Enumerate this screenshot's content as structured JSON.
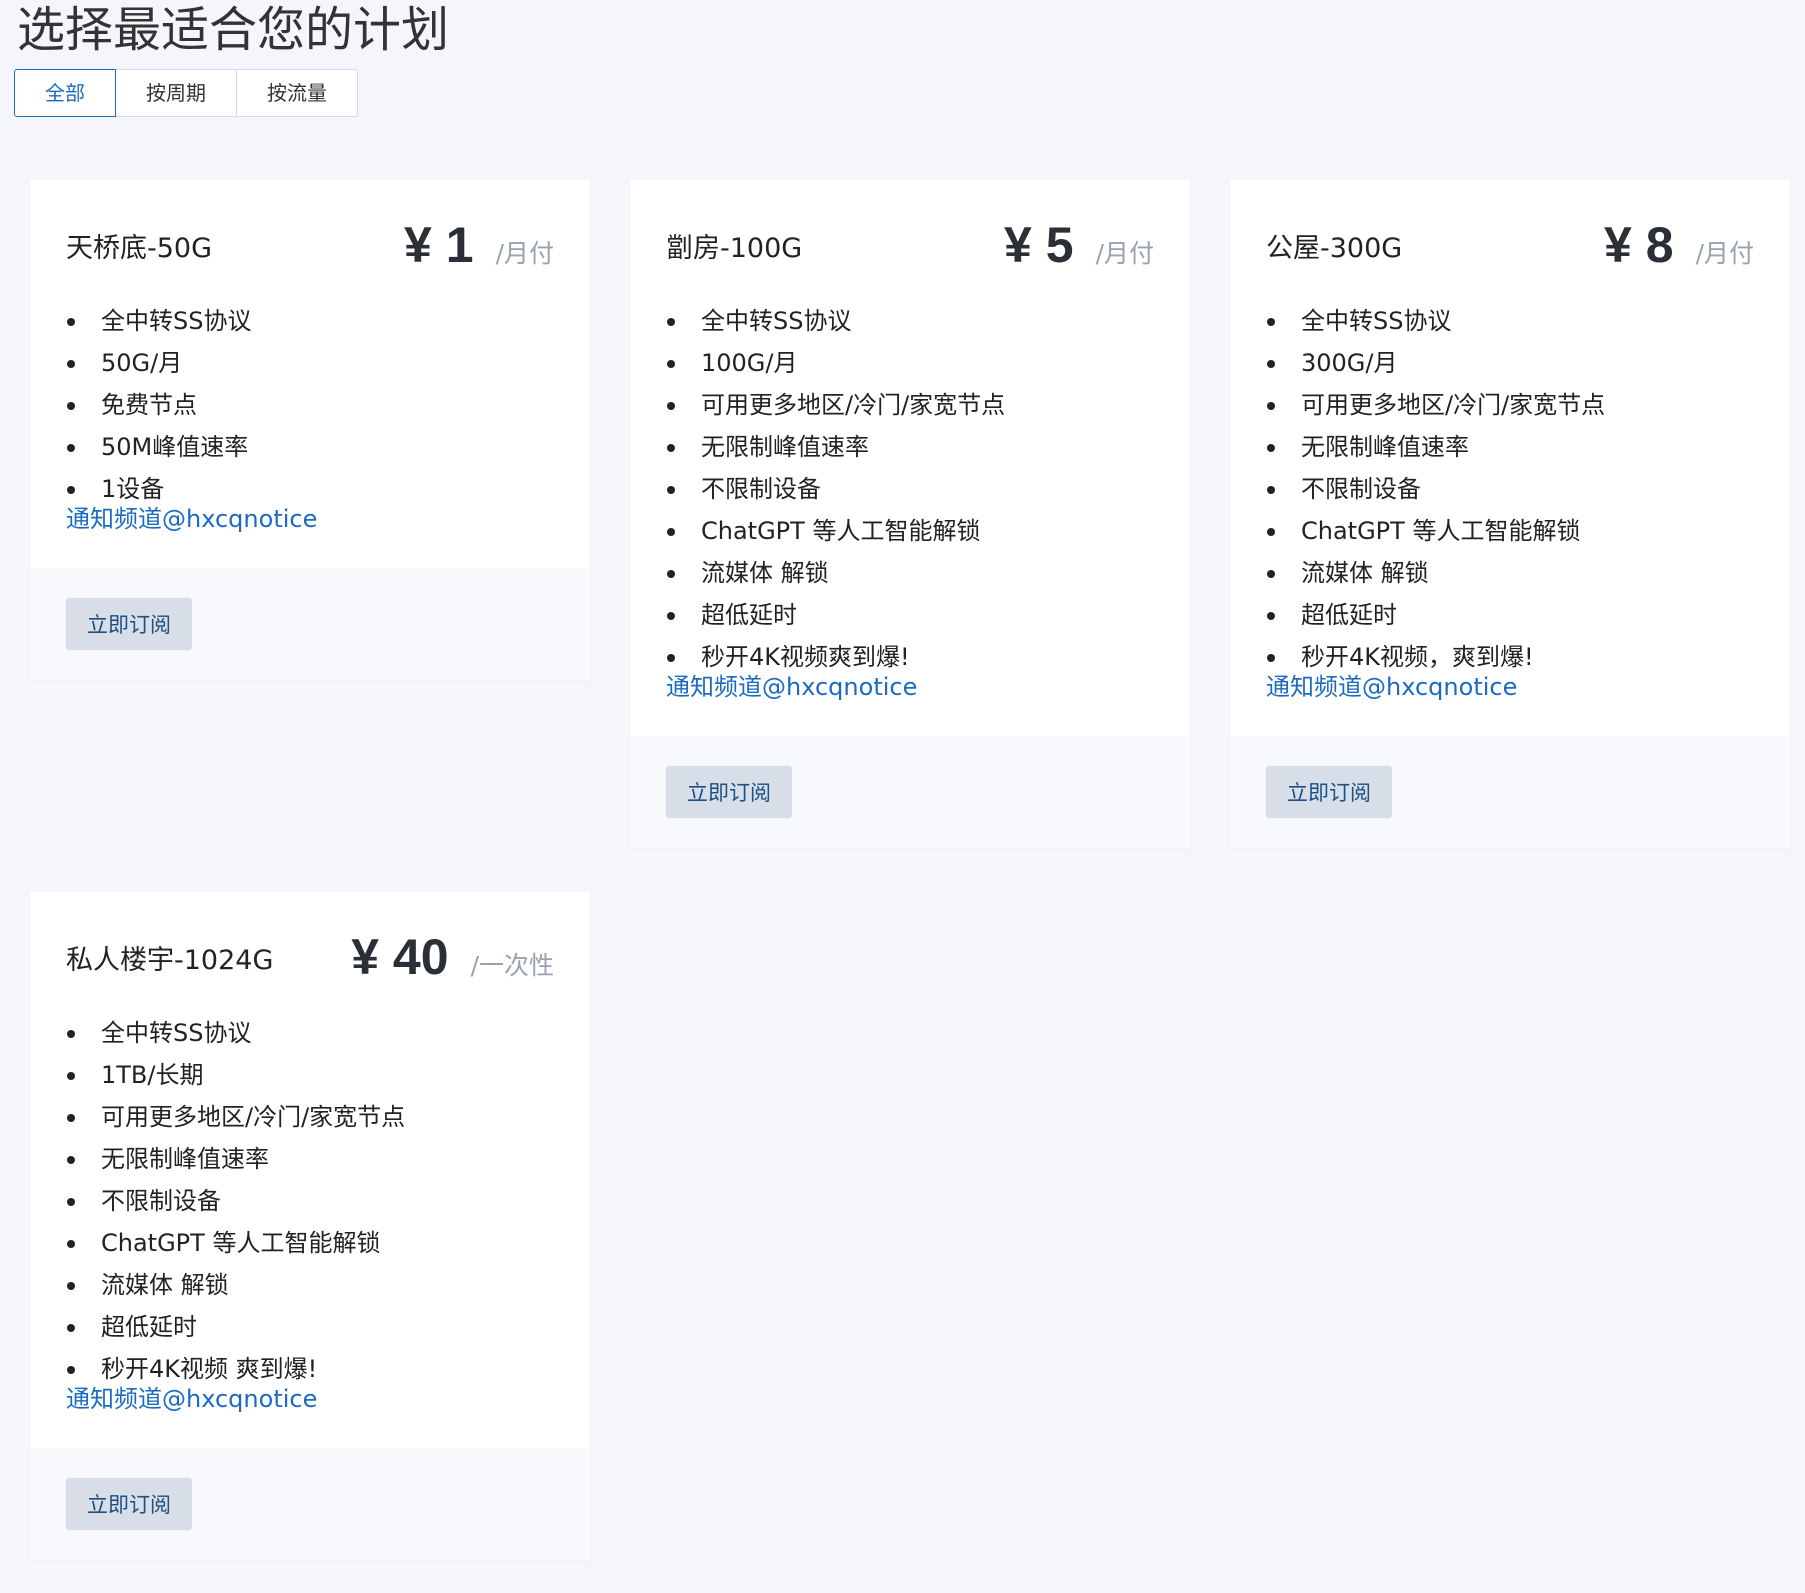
{
  "page": {
    "title": "选择最适合您的计划"
  },
  "tabs": [
    {
      "label": "全部",
      "active": true
    },
    {
      "label": "按周期",
      "active": false
    },
    {
      "label": "按流量",
      "active": false
    }
  ],
  "plans": [
    {
      "name": "天桥底-50G",
      "price": "¥ 1",
      "period": "/月付",
      "features": [
        "全中转SS协议",
        "50G/月",
        "免费节点",
        "50M峰值速率",
        "1设备"
      ],
      "notice": "通知频道@hxcqnotice",
      "button": "立即订阅"
    },
    {
      "name": "劏房-100G",
      "price": "¥ 5",
      "period": "/月付",
      "features": [
        "全中转SS协议",
        "100G/月",
        "可用更多地区/冷门/家宽节点",
        "无限制峰值速率",
        "不限制设备",
        "ChatGPT 等人工智能解锁",
        "流媒体 解锁",
        "超低延时",
        "秒开4K视频爽到爆!"
      ],
      "notice": "通知频道@hxcqnotice",
      "button": "立即订阅"
    },
    {
      "name": "公屋-300G",
      "price": "¥ 8",
      "period": "/月付",
      "features": [
        "全中转SS协议",
        "300G/月",
        "可用更多地区/冷门/家宽节点",
        "无限制峰值速率",
        "不限制设备",
        "ChatGPT 等人工智能解锁",
        "流媒体 解锁",
        "超低延时",
        "秒开4K视频，爽到爆!"
      ],
      "notice": "通知频道@hxcqnotice",
      "button": "立即订阅"
    },
    {
      "name": "私人楼宇-1024G",
      "price": "¥ 40",
      "period": "/一次性",
      "features": [
        "全中转SS协议",
        "1TB/长期",
        "可用更多地区/冷门/家宽节点",
        "无限制峰值速率",
        "不限制设备",
        "ChatGPT 等人工智能解锁",
        "流媒体 解锁",
        "超低延时",
        "秒开4K视频 爽到爆!"
      ],
      "notice": "通知频道@hxcqnotice",
      "button": "立即订阅"
    }
  ]
}
